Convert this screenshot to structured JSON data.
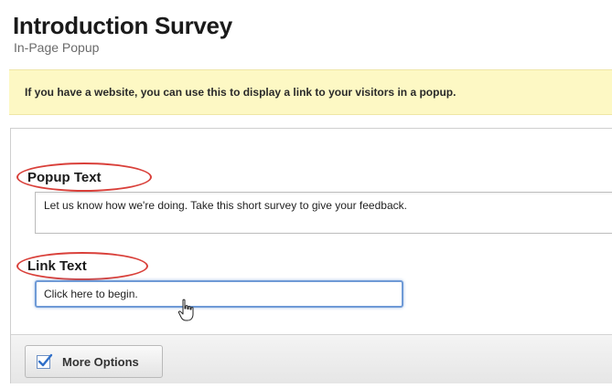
{
  "header": {
    "title": "Introduction Survey",
    "subtitle": "In-Page Popup"
  },
  "notice": {
    "text": "If you have a website, you can use this to display a link to your visitors in a popup."
  },
  "form": {
    "popup_text_label": "Popup Text",
    "popup_text_value": "Let us know how we're doing. Take this short survey to give your feedback.",
    "link_text_label": "Link Text",
    "link_text_value": "Click here to begin."
  },
  "footer": {
    "more_options_label": "More Options",
    "more_options_checked": true
  },
  "colors": {
    "notice_bg": "#fdf8c4",
    "highlight_ellipse": "#d9403a",
    "input_focus": "#6f9ad6",
    "checkbox_accent": "#2f6fc9"
  },
  "icons": {
    "cursor": "hand-pointer-icon",
    "checkbox": "checkmark-icon"
  }
}
